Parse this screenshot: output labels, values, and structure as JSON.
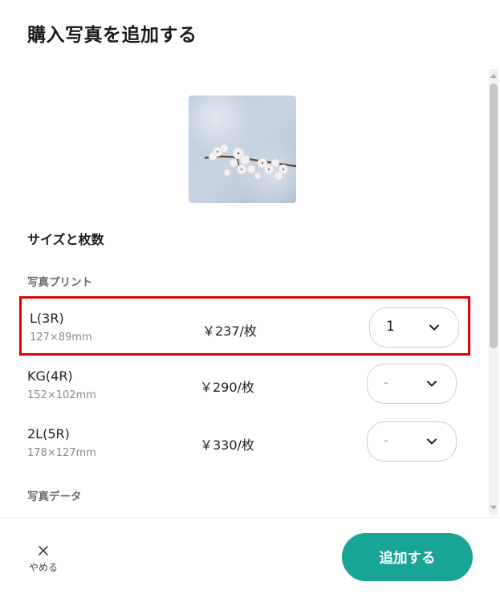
{
  "modal": {
    "title": "購入写真を追加する"
  },
  "photo": {
    "alt": "cherry-blossom-photo"
  },
  "section": {
    "heading": "サイズと枚数"
  },
  "groups": {
    "print_label": "写真プリント",
    "data_label": "写真データ"
  },
  "options": [
    {
      "name": "L(3R)",
      "dimensions": "127×89mm",
      "price": "￥237/枚",
      "quantity": "1",
      "selected": true
    },
    {
      "name": "KG(4R)",
      "dimensions": "152×102mm",
      "price": "￥290/枚",
      "quantity": "-",
      "selected": false
    },
    {
      "name": "2L(5R)",
      "dimensions": "178×127mm",
      "price": "￥330/枚",
      "quantity": "-",
      "selected": false
    }
  ],
  "footer": {
    "cancel_label": "やめる",
    "add_label": "追加する"
  },
  "colors": {
    "accent": "#19a596",
    "highlight": "#e00000"
  }
}
